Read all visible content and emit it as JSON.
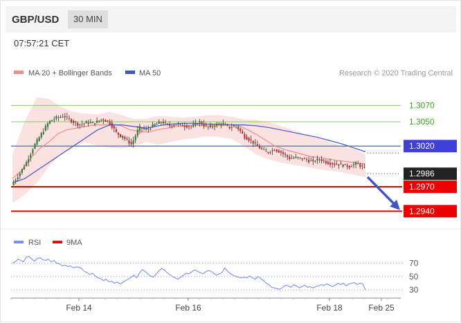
{
  "header": {
    "symbol": "GBP/USD",
    "timeframe": "30 MIN"
  },
  "time_label": "07:57:21 CET",
  "chart_data": [
    {
      "type": "candlestick",
      "legend": [
        {
          "label": "MA 20 + Bollinger Bands",
          "color": "#f08c8c"
        },
        {
          "label": "MA 50",
          "color": "#3f56c4"
        }
      ],
      "credit": "Research © 2020 Trading Central",
      "x_ticks": [
        "Feb 14",
        "Feb 16",
        "Feb 18",
        "Feb 25"
      ],
      "ylim": [
        1.2925,
        1.3095
      ],
      "current_price": {
        "value": "1.2986",
        "price": 1.2986
      },
      "levels": [
        {
          "value": "1.3070",
          "price": 1.307,
          "kind": "target"
        },
        {
          "value": "1.3050",
          "price": 1.305,
          "kind": "target"
        },
        {
          "value": "1.3020",
          "price": 1.302,
          "kind": "pivot"
        },
        {
          "value": "1.2970",
          "price": 1.297,
          "kind": "target-down"
        },
        {
          "value": "1.2940",
          "price": 1.294,
          "kind": "target-down"
        }
      ],
      "close_path": [
        1.2972,
        1.2985,
        1.3,
        1.302,
        1.3035,
        1.305,
        1.3055,
        1.3057,
        1.3051,
        1.3046,
        1.3049,
        1.3048,
        1.3053,
        1.305,
        1.3036,
        1.303,
        1.3022,
        1.3043,
        1.304,
        1.3046,
        1.305,
        1.3045,
        1.3047,
        1.3045,
        1.3044,
        1.305,
        1.3043,
        1.3045,
        1.3048,
        1.3043,
        1.3044,
        1.3032,
        1.3026,
        1.3018,
        1.3012,
        1.3016,
        1.3012,
        1.3005,
        1.3006,
        1.3004,
        1.3001,
        1.3004,
        1.3,
        1.2998,
        1.2997,
        1.2995,
        1.2999,
        1.2992
      ],
      "ma20": [
        1.298,
        1.299,
        1.3005,
        1.3017,
        1.3025,
        1.3035,
        1.304,
        1.3042,
        1.3044,
        1.3046,
        1.3046,
        1.3047,
        1.3045,
        1.304,
        1.3038,
        1.3037,
        1.304,
        1.3042,
        1.3044,
        1.3045,
        1.3046,
        1.3045,
        1.3045,
        1.3045,
        1.3046,
        1.3045,
        1.304,
        1.3034,
        1.3027,
        1.302,
        1.3016,
        1.3013,
        1.301,
        1.3007,
        1.3006,
        1.3004,
        1.3002,
        1.3001,
        1.2999,
        1.2998
      ],
      "ma50": [
        1.2975,
        1.298,
        1.299,
        1.3,
        1.301,
        1.302,
        1.303,
        1.304,
        1.3046,
        1.3046,
        1.3044,
        1.3042,
        1.3045,
        1.3047,
        1.3048,
        1.3048,
        1.3047,
        1.3047,
        1.3046,
        1.3046,
        1.3045,
        1.3043,
        1.304,
        1.3037,
        1.3034,
        1.3031,
        1.3027,
        1.3023,
        1.3018,
        1.3013
      ],
      "bb_upper": [
        1.301,
        1.305,
        1.308,
        1.3078,
        1.3068,
        1.3062,
        1.306,
        1.3059,
        1.3062,
        1.3058,
        1.3053,
        1.3054,
        1.3057,
        1.3056,
        1.3055,
        1.3056,
        1.3058,
        1.3058,
        1.3056,
        1.3053,
        1.3052,
        1.305,
        1.3045,
        1.304,
        1.3035,
        1.303,
        1.3025,
        1.302,
        1.3017,
        1.301
      ],
      "bb_lower": [
        1.295,
        1.296,
        1.2975,
        1.2995,
        1.301,
        1.3018,
        1.3025,
        1.302,
        1.3018,
        1.3017,
        1.302,
        1.3025,
        1.3022,
        1.3025,
        1.3028,
        1.303,
        1.3032,
        1.3031,
        1.3029,
        1.302,
        1.301,
        1.3004,
        1.3,
        1.2997,
        1.2995,
        1.2992,
        1.299,
        1.2988,
        1.2985,
        1.2982
      ]
    },
    {
      "type": "line",
      "legend": [
        {
          "label": "RSI",
          "color": "#7b8ff0"
        },
        {
          "label": "9MA",
          "color": "#dd1111"
        }
      ],
      "ylim": [
        22,
        90
      ],
      "y_ticks": [
        "70",
        "50",
        "30"
      ],
      "y_tick_values": [
        70,
        50,
        30
      ],
      "rsi": [
        70,
        72,
        76,
        74,
        72,
        79,
        80,
        76,
        73,
        77,
        78,
        75,
        74,
        76,
        72,
        74,
        70,
        69,
        66,
        67,
        65,
        66,
        63,
        64,
        64,
        62,
        58,
        56,
        53,
        55,
        51,
        48,
        47,
        44,
        46,
        42,
        43,
        40,
        42,
        39,
        41,
        44,
        46,
        49,
        52,
        48,
        55,
        60,
        58,
        54,
        51,
        49,
        53,
        58,
        62,
        60,
        56,
        53,
        50,
        48,
        46,
        49,
        52,
        55,
        54,
        57,
        60,
        58,
        56,
        54,
        57,
        59,
        58,
        55,
        52,
        54,
        56,
        63,
        58,
        54,
        52,
        50,
        49,
        48,
        49,
        48,
        51,
        48,
        46,
        50,
        47,
        44,
        40,
        38,
        34,
        33,
        32,
        31,
        34,
        37,
        36,
        34,
        38,
        36,
        33,
        35,
        37,
        34,
        35,
        33,
        35,
        36,
        38,
        37,
        39,
        37,
        35,
        37,
        40,
        38,
        40,
        36,
        39,
        40,
        41,
        38,
        40,
        39,
        30
      ]
    }
  ]
}
